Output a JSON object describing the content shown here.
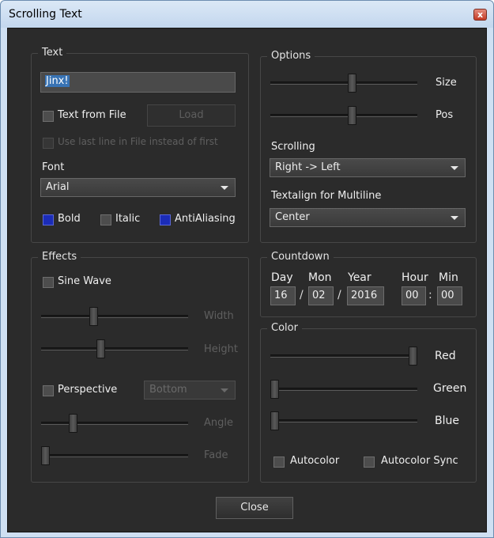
{
  "window": {
    "title": "Scrolling Text",
    "close_glyph": "x"
  },
  "text_group": {
    "legend": "Text",
    "text_value": "Jinx!",
    "text_from_file_label": "Text from File",
    "load_label": "Load",
    "use_last_line_label": "Use last line in File instead of first",
    "font_label": "Font",
    "font_value": "Arial",
    "bold_label": "Bold",
    "italic_label": "Italic",
    "antialiasing_label": "AntiAliasing"
  },
  "effects_group": {
    "legend": "Effects",
    "sine_wave_label": "Sine Wave",
    "width_label": "Width",
    "height_label": "Height",
    "perspective_label": "Perspective",
    "perspective_value": "Bottom",
    "angle_label": "Angle",
    "fade_label": "Fade",
    "width_level": 0.35,
    "height_level": 0.4,
    "angle_level": 0.2,
    "fade_level": 0.0
  },
  "options_group": {
    "legend": "Options",
    "size_label": "Size",
    "pos_label": "Pos",
    "size_level": 0.56,
    "pos_level": 0.56,
    "scrolling_label": "Scrolling",
    "scrolling_value": "Right -> Left",
    "textalign_label": "Textalign for Multiline",
    "textalign_value": "Center"
  },
  "countdown_group": {
    "legend": "Countdown",
    "day_label": "Day",
    "mon_label": "Mon",
    "year_label": "Year",
    "hour_label": "Hour",
    "min_label": "Min",
    "day_value": "16",
    "mon_value": "02",
    "year_value": "2016",
    "hour_value": "00",
    "min_value": "00",
    "date_sep": "/",
    "time_sep": ":"
  },
  "color_group": {
    "legend": "Color",
    "red_label": "Red",
    "green_label": "Green",
    "blue_label": "Blue",
    "red_level": 1.0,
    "green_level": 0.0,
    "blue_level": 0.0,
    "autocolor_label": "Autocolor",
    "autocolor_sync_label": "Autocolor Sync"
  },
  "footer": {
    "close_label": "Close"
  },
  "colors": {
    "background": "#2b2b2b",
    "checked": "#1b2cb8",
    "selection": "#3873b4"
  }
}
